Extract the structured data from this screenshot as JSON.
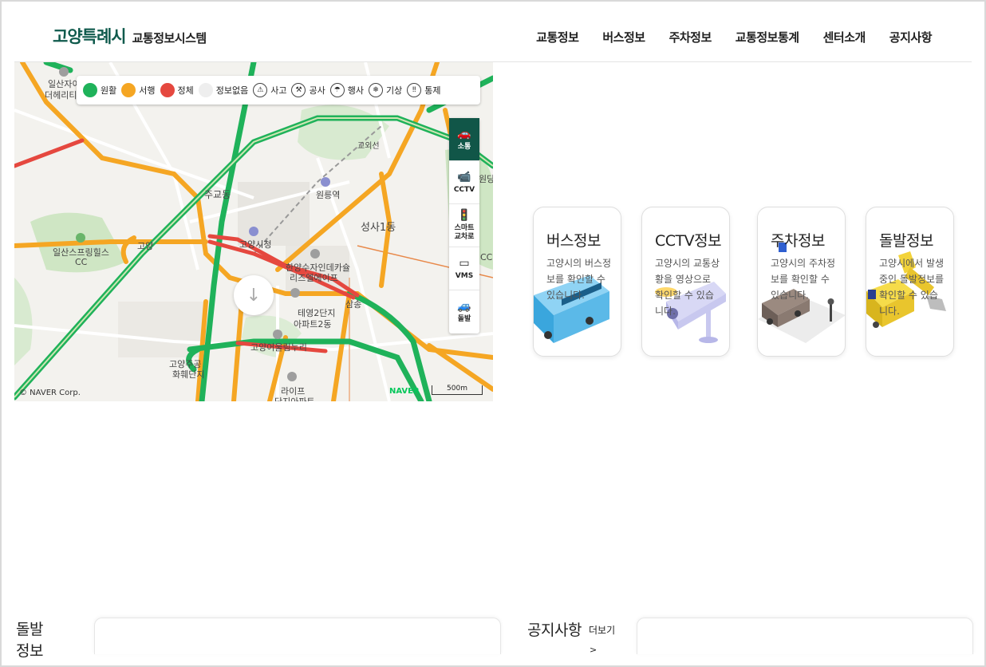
{
  "header": {
    "logo_main": "고양특례시",
    "logo_sub": "교통정보시스템",
    "nav": [
      "교통정보",
      "버스정보",
      "주차정보",
      "교통정보통계",
      "센터소개",
      "공지사항"
    ]
  },
  "map": {
    "legend": {
      "smooth": "원활",
      "slow": "서행",
      "congested": "정체",
      "no_info": "정보없음",
      "accident": "사고",
      "construction": "공사",
      "event": "행사",
      "weather": "기상",
      "control": "통제"
    },
    "legend_colors": {
      "smooth": "#1fb25a",
      "slow": "#f5a623",
      "congested": "#e5483f",
      "no_info": "#eeeeee"
    },
    "tools": [
      {
        "line1": "소통",
        "line2": ""
      },
      {
        "line1": "CCTV",
        "line2": ""
      },
      {
        "line1": "스마트",
        "line2": "교차로"
      },
      {
        "line1": "VMS",
        "line2": ""
      },
      {
        "line1": "돌발",
        "line2": ""
      }
    ],
    "labels": {
      "l1": "일산자이",
      "l2": "더헤리티",
      "l3": "주교동",
      "l4": "원릉역",
      "l5": "성사1동",
      "l6": "일산스프링힐스",
      "l7": "CC",
      "l8": "고양시청",
      "l9": "고양",
      "l10": "삼송",
      "l11": "교외선",
      "l12": "한양수자인데카슐",
      "l13": "리즈엘에이프",
      "l14": "테영2단지",
      "l15": "아파트2동",
      "l16": "고양어울림누리",
      "l17": "고양주공",
      "l18": "화훼단지",
      "l19": "라이프",
      "l20": "단지아파트",
      "l21": "원당",
      "l22": "CC"
    },
    "copyright": "© NAVER Corp.",
    "naver": "NAVER",
    "scale": "500m"
  },
  "cards": [
    {
      "title": "버스정보",
      "desc": "고양시의 버스정보를 확인할 수 있습니다."
    },
    {
      "title": "CCTV정보",
      "desc": "고양시의 교통상황을 영상으로 확인할 수 있습니다."
    },
    {
      "title": "주차정보",
      "desc": "고양시의 주차정보를 확인할 수 있습니다."
    },
    {
      "title": "돌발정보",
      "desc": "고양시에서 발생중인 돌발정보를 확인할 수 있습니다."
    }
  ],
  "bottom": {
    "incident_title_1": "돌발",
    "incident_title_2": "정보",
    "notice_title": "공지사항",
    "more": "더보기",
    "more_arrow": ">"
  }
}
